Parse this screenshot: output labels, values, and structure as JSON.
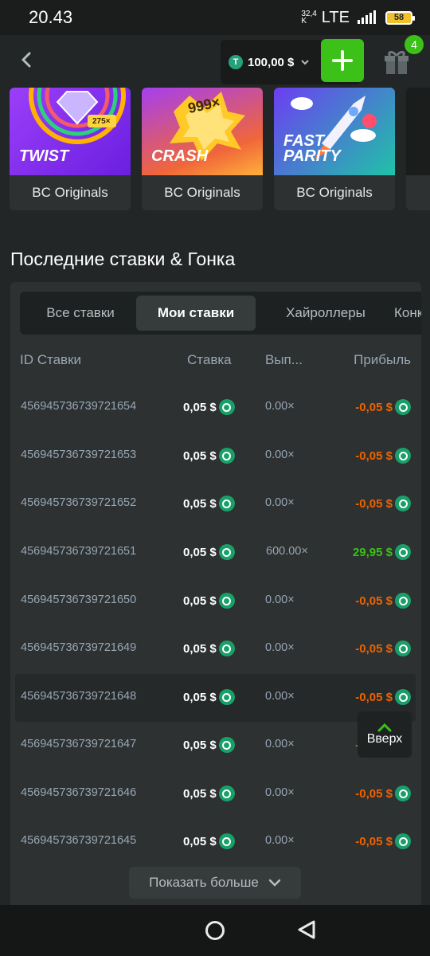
{
  "status_bar": {
    "time": "20.43",
    "net_speed_top": "32,4",
    "net_speed_bottom": "K",
    "network": "LTE",
    "battery": "58"
  },
  "header": {
    "balance": "100,00 $",
    "currency_icon": "T",
    "notifications": "4"
  },
  "games": [
    {
      "title_line1": "TWIST",
      "title_line2": "",
      "badge": "275×",
      "provider": "BC Originals",
      "art_color": "#7b2ff7"
    },
    {
      "title_line1": "CRASH",
      "title_line2": "",
      "badge": "999×",
      "provider": "BC Originals",
      "art_color": "#f26a1b"
    },
    {
      "title_line1": "FAST",
      "title_line2": "PARITY",
      "badge": "",
      "provider": "BC Originals",
      "art_color": "#22c1a3"
    }
  ],
  "section_title": "Последние ставки & Гонка",
  "tabs": [
    "Все ставки",
    "Мои ставки",
    "Хайроллеры",
    "Конк"
  ],
  "active_tab": "Мои ставки",
  "table": {
    "headers": {
      "id": "ID Ставки",
      "bet": "Ставка",
      "payout": "Вып...",
      "profit": "Прибыль"
    },
    "rows": [
      {
        "id": "456945736739721654",
        "bet": "0,05 $",
        "payout": "0.00×",
        "profit": "-0,05 $",
        "sign": "neg"
      },
      {
        "id": "456945736739721653",
        "bet": "0,05 $",
        "payout": "0.00×",
        "profit": "-0,05 $",
        "sign": "neg"
      },
      {
        "id": "456945736739721652",
        "bet": "0,05 $",
        "payout": "0.00×",
        "profit": "-0,05 $",
        "sign": "neg"
      },
      {
        "id": "456945736739721651",
        "bet": "0,05 $",
        "payout": "600.00×",
        "profit": "29,95 $",
        "sign": "pos"
      },
      {
        "id": "456945736739721650",
        "bet": "0,05 $",
        "payout": "0.00×",
        "profit": "-0,05 $",
        "sign": "neg"
      },
      {
        "id": "456945736739721649",
        "bet": "0,05 $",
        "payout": "0.00×",
        "profit": "-0,05 $",
        "sign": "neg"
      },
      {
        "id": "456945736739721648",
        "bet": "0,05 $",
        "payout": "0.00×",
        "profit": "-0,05 $",
        "sign": "neg"
      },
      {
        "id": "456945736739721647",
        "bet": "0,05 $",
        "payout": "0.00×",
        "profit": "-0,05 $",
        "sign": "neg"
      },
      {
        "id": "456945736739721646",
        "bet": "0,05 $",
        "payout": "0.00×",
        "profit": "-0,05 $",
        "sign": "neg"
      },
      {
        "id": "456945736739721645",
        "bet": "0,05 $",
        "payout": "0.00×",
        "profit": "-0,05 $",
        "sign": "neg"
      }
    ]
  },
  "scroll_top_label": "Вверх",
  "show_more_label": "Показать больше",
  "colors": {
    "accent_green": "#3bc117",
    "loss_orange": "#ed6300",
    "coin_green": "#19a06a"
  }
}
